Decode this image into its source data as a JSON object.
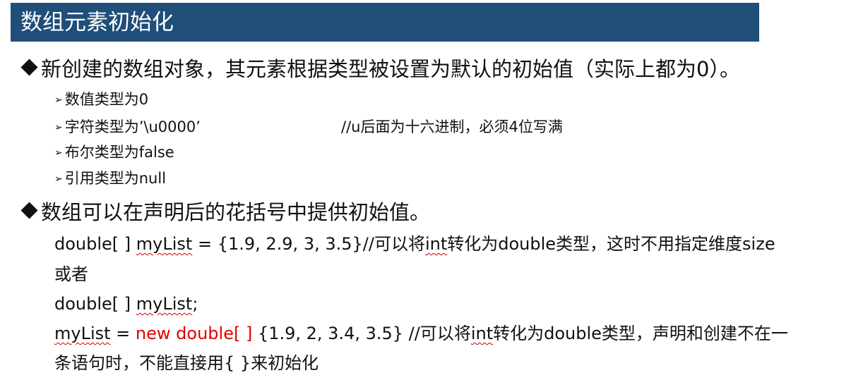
{
  "title": "数组元素初始化",
  "bullet1": {
    "text": "新创建的数组对象，其元素根据类型被设置为默认的初始值（实际上都为0）。",
    "items": [
      {
        "label": "数值类型为0"
      },
      {
        "label": "字符类型为’\\u0000’",
        "comment": "//u后面为十六进制，必须4位写满"
      },
      {
        "label": "布尔类型为false"
      },
      {
        "label": "引用类型为null"
      }
    ]
  },
  "bullet2": {
    "text": "数组可以在声明后的花括号中提供初始值。"
  },
  "code": {
    "line1_prefix": "double[ ] ",
    "line1_var": "myList",
    "line1_mid": " = {1.9, 2.9, 3, 3.5}//可以将",
    "line1_int": "int",
    "line1_suffix": "转化为double类型，这时不用指定维度size",
    "line2": "或者",
    "line3_prefix": "double[ ] ",
    "line3_var": "myList",
    "line3_suffix": ";",
    "line4_var": "myList",
    "line4_eq": " = ",
    "line4_new": "new double[ ]",
    "line4_mid": " {1.9, 2, 3.4, 3.5} //可以将",
    "line4_int": "int",
    "line4_suffix": "转化为double类型，声明和创建不在一",
    "line5": "条语句时，不能直接用{ }来初始化"
  },
  "colors": {
    "title_bar": "#1f4e79",
    "highlight": "#e00000",
    "spellcheck_underline": "#d00000"
  },
  "icons": {
    "bullet": "diamond-bullet-icon",
    "sub_bullet": "arrow-bullet-icon"
  }
}
